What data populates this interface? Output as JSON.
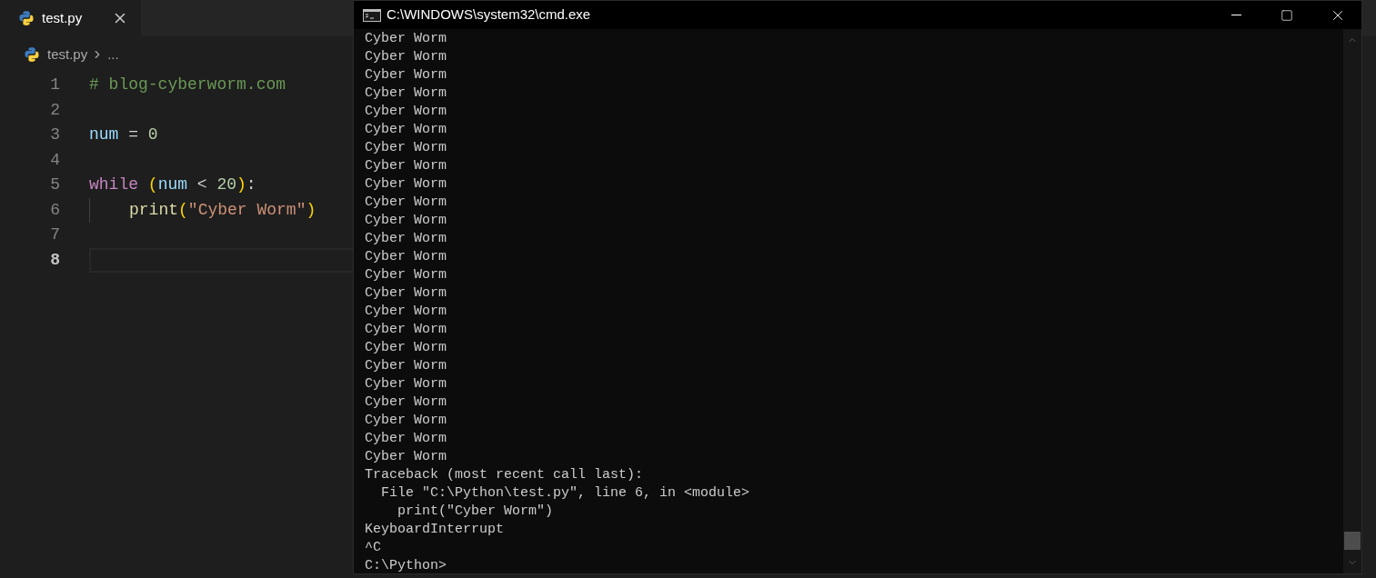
{
  "editor": {
    "tabs": [
      {
        "label": "test.py",
        "selected": true
      }
    ],
    "breadcrumb": {
      "file": "test.py",
      "more": "..."
    },
    "lines": [
      {
        "number": "1",
        "current": false,
        "tokens": [
          {
            "kind": "comment",
            "text": "# blog-cyberworm.com"
          }
        ]
      },
      {
        "number": "2",
        "current": false
      },
      {
        "number": "3",
        "current": false,
        "tokens": [
          {
            "kind": "variable",
            "text": "num"
          },
          {
            "kind": "operator",
            "text": " = "
          },
          {
            "kind": "number",
            "text": "0"
          }
        ]
      },
      {
        "number": "4",
        "current": false
      },
      {
        "number": "5",
        "current": false,
        "tokens": [
          {
            "kind": "keyword",
            "text": "while"
          },
          {
            "kind": "bracket",
            "text": " ("
          },
          {
            "kind": "variable",
            "text": "num"
          },
          {
            "kind": "operator",
            "text": " < "
          },
          {
            "kind": "number",
            "text": "20"
          },
          {
            "kind": "bracket",
            "text": ")"
          },
          {
            "kind": "operator",
            "text": ":"
          }
        ]
      },
      {
        "number": "6",
        "current": false,
        "indent_guide": true,
        "tokens": [
          {
            "kind": "function",
            "text": "print"
          },
          {
            "kind": "bracket",
            "text": "("
          },
          {
            "kind": "string",
            "text": "\"Cyber Worm\""
          },
          {
            "kind": "bracket",
            "text": ")"
          }
        ]
      },
      {
        "number": "7",
        "current": false
      },
      {
        "number": "8",
        "current": true
      }
    ]
  },
  "console": {
    "title": "C:\\WINDOWS\\system32\\cmd.exe",
    "lines": [
      "Cyber Worm",
      "Cyber Worm",
      "Cyber Worm",
      "Cyber Worm",
      "Cyber Worm",
      "Cyber Worm",
      "Cyber Worm",
      "Cyber Worm",
      "Cyber Worm",
      "Cyber Worm",
      "Cyber Worm",
      "Cyber Worm",
      "Cyber Worm",
      "Cyber Worm",
      "Cyber Worm",
      "Cyber Worm",
      "Cyber Worm",
      "Cyber Worm",
      "Cyber Worm",
      "Cyber Worm",
      "Cyber Worm",
      "Cyber Worm",
      "Cyber Worm",
      "Cyber Worm",
      "Traceback (most recent call last):",
      "  File \"C:\\Python\\test.py\", line 6, in <module>",
      "    print(\"Cyber Worm\")",
      "KeyboardInterrupt",
      "^C",
      "C:\\Python>"
    ]
  }
}
